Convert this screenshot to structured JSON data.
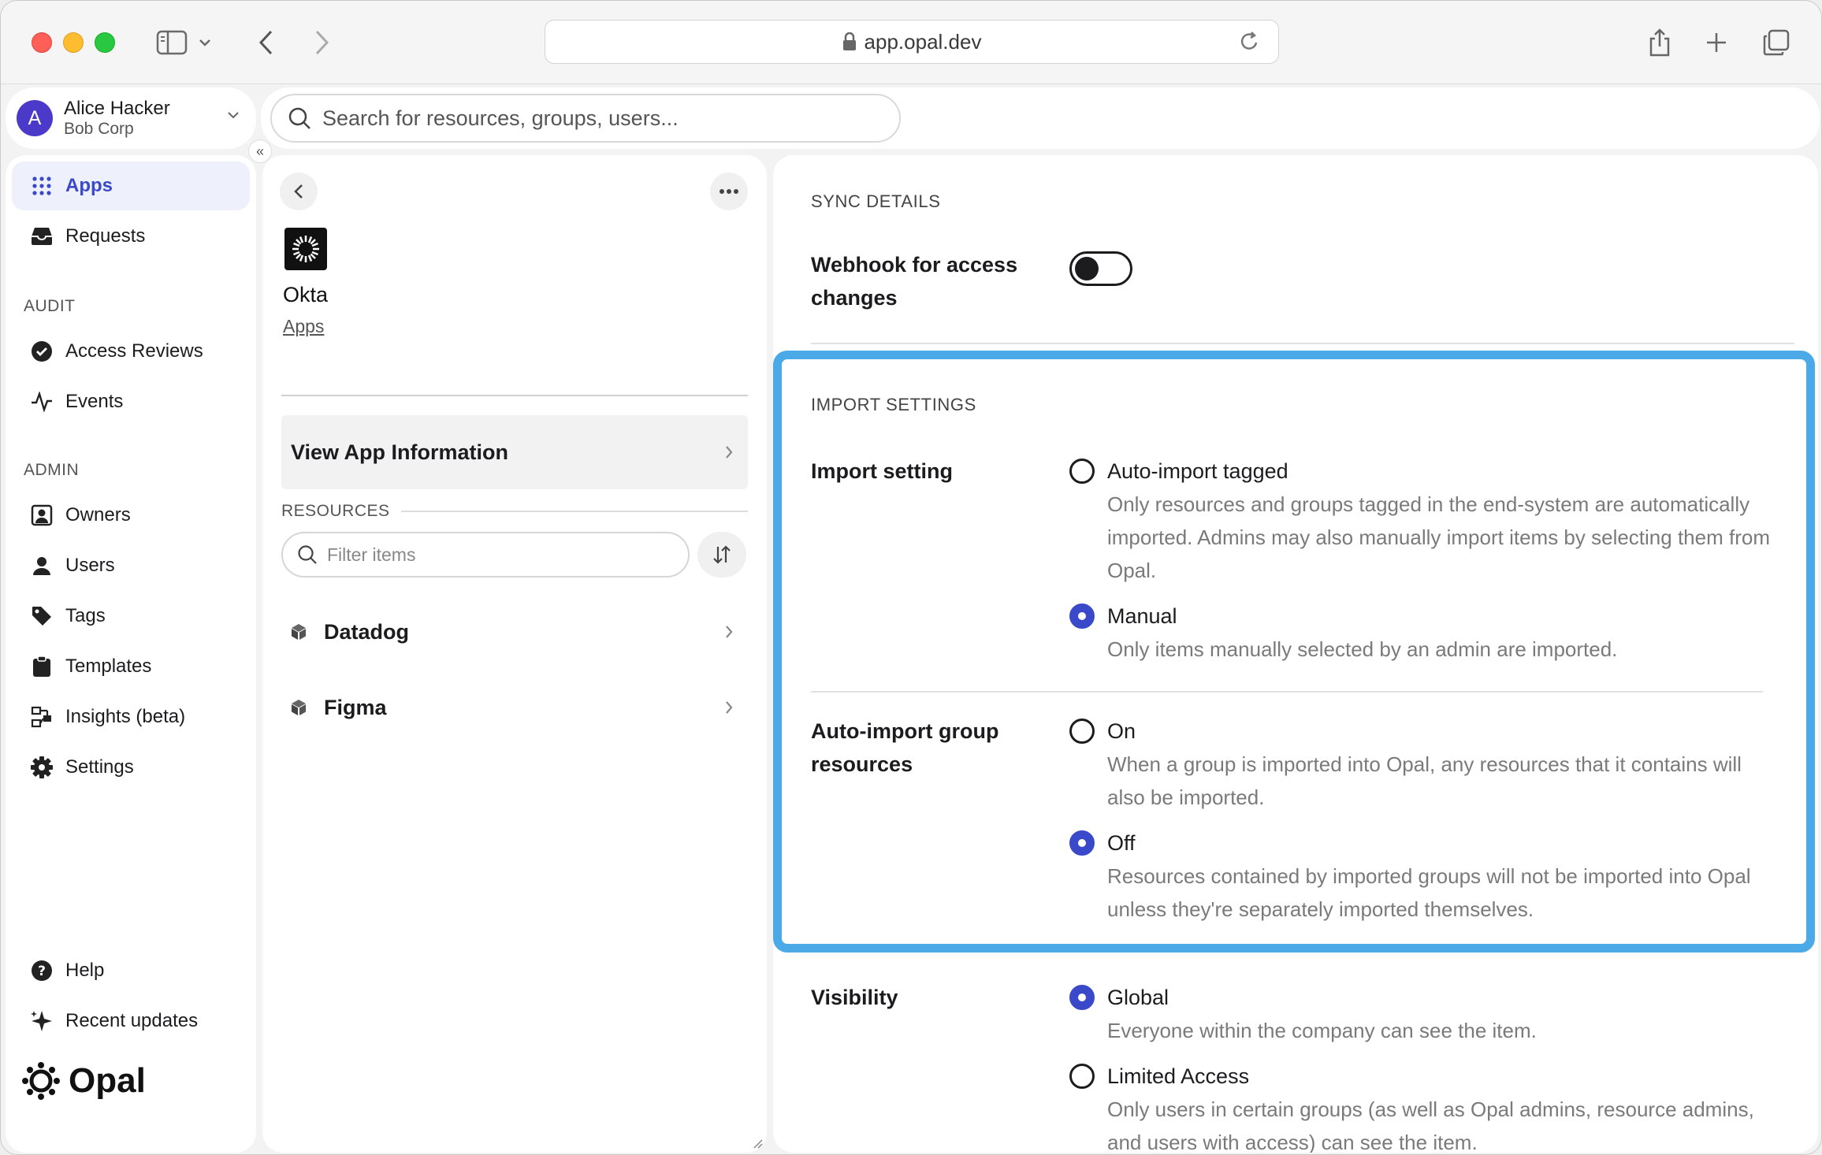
{
  "browser": {
    "url": "app.opal.dev"
  },
  "account": {
    "avatar_letter": "A",
    "name": "Alice Hacker",
    "org": "Bob Corp"
  },
  "search": {
    "placeholder": "Search for resources, groups, users..."
  },
  "collapse_label": "«",
  "sidebar": {
    "items_top": [
      {
        "label": "Apps",
        "icon": "grid-icon",
        "active": true
      },
      {
        "label": "Requests",
        "icon": "inbox-icon"
      }
    ],
    "audit_title": "AUDIT",
    "audit_items": [
      {
        "label": "Access Reviews",
        "icon": "check-circle-icon"
      },
      {
        "label": "Events",
        "icon": "activity-icon"
      }
    ],
    "admin_title": "ADMIN",
    "admin_items": [
      {
        "label": "Owners",
        "icon": "owner-badge-icon"
      },
      {
        "label": "Users",
        "icon": "user-icon"
      },
      {
        "label": "Tags",
        "icon": "tag-icon"
      },
      {
        "label": "Templates",
        "icon": "clipboard-icon"
      },
      {
        "label": "Insights (beta)",
        "icon": "insights-icon"
      },
      {
        "label": "Settings",
        "icon": "gear-icon"
      }
    ],
    "bottom_items": [
      {
        "label": "Help",
        "icon": "help-circle-icon"
      },
      {
        "label": "Recent updates",
        "icon": "sparkle-icon"
      }
    ],
    "brand": "Opal"
  },
  "app_panel": {
    "app_name": "Okta",
    "breadcrumb": "Apps",
    "view_info_label": "View App Information",
    "resources_title": "RESOURCES",
    "filter_placeholder": "Filter items",
    "resources": [
      "Datadog",
      "Figma"
    ]
  },
  "sync_details": {
    "title": "SYNC DETAILS",
    "webhook_label": "Webhook for access changes",
    "webhook_enabled": false
  },
  "import_settings": {
    "title": "IMPORT SETTINGS",
    "import_setting": {
      "label": "Import setting",
      "options": [
        {
          "title": "Auto-import tagged",
          "desc": "Only resources and groups tagged in the end-system are automatically imported. Admins may also manually import items by selecting them from Opal.",
          "selected": false
        },
        {
          "title": "Manual",
          "desc": "Only items manually selected by an admin are imported.",
          "selected": true
        }
      ]
    },
    "auto_import_group": {
      "label": "Auto-import group resources",
      "options": [
        {
          "title": "On",
          "desc": "When a group is imported into Opal, any resources that it contains will also be imported.",
          "selected": false
        },
        {
          "title": "Off",
          "desc": "Resources contained by imported groups will not be imported into Opal unless they're separately imported themselves.",
          "selected": true
        }
      ]
    }
  },
  "visibility": {
    "label": "Visibility",
    "options": [
      {
        "title": "Global",
        "desc": "Everyone within the company can see the item.",
        "selected": true
      },
      {
        "title": "Limited Access",
        "desc": "Only users in certain groups (as well as Opal admins, resource admins, and users with access) can see the item.",
        "selected": false
      }
    ]
  },
  "colors": {
    "accent": "#3a49c9",
    "highlight": "#4aa9e6"
  }
}
